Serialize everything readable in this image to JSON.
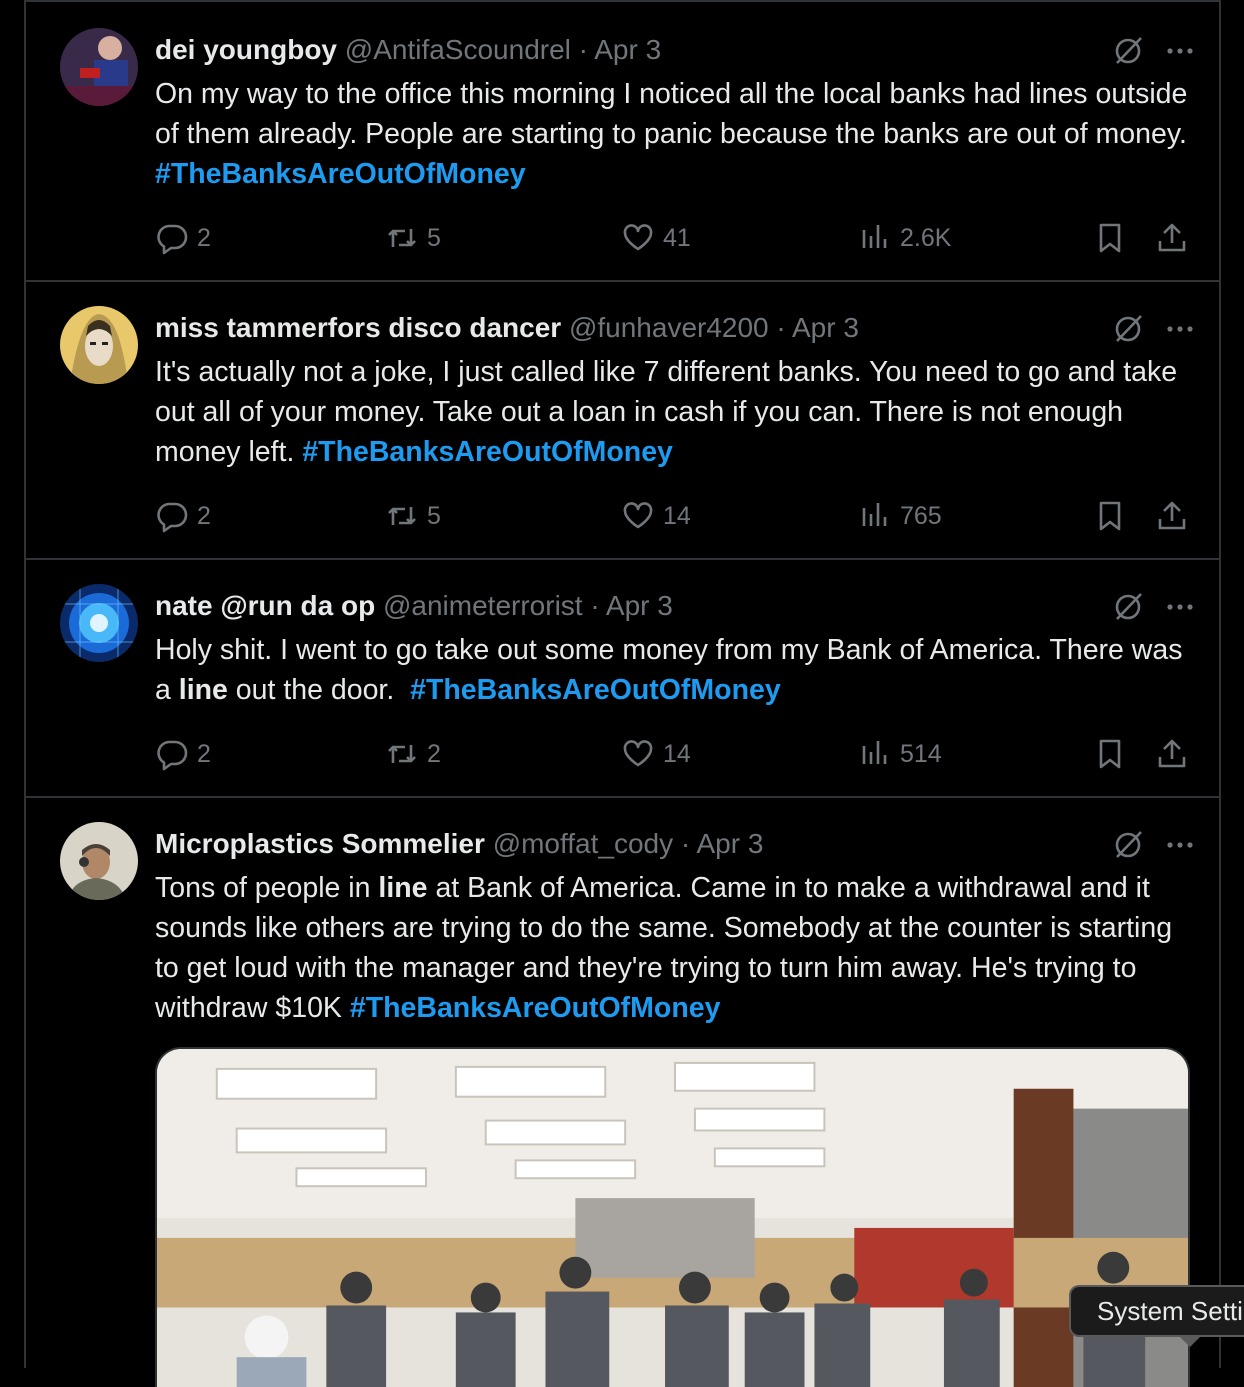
{
  "colors": {
    "background": "#000000",
    "text": "#e7e9ea",
    "muted": "#71767b",
    "hashtag": "#1d9bf0",
    "border": "#2f3336"
  },
  "icons": {
    "reply": "speech-bubble-icon",
    "retweet": "retweet-arrows-icon",
    "like": "heart-icon",
    "views": "bar-chart-icon",
    "bookmark": "bookmark-icon",
    "share": "share-upload-icon",
    "grok": "grok-slash-icon",
    "more": "ellipsis-icon"
  },
  "tweets": [
    {
      "name": "dei youngboy",
      "handle": "@AntifaScoundrel",
      "sep": "·",
      "date": "Apr 3",
      "text1": "On my way to the office this morning I noticed all the local banks had lines outside of them already. People are starting to panic because the banks are out of money. ",
      "hashtag": "#TheBanksAreOutOfMoney",
      "replies": "2",
      "retweets": "5",
      "likes": "41",
      "views": "2.6K"
    },
    {
      "name": "miss tammerfors disco dancer",
      "handle": "@funhaver4200",
      "sep": "·",
      "date": "Apr 3",
      "text1": "It's actually not a joke, I just called like 7 different banks. You need to go and take out all of your money. Take out a loan in cash if you can. There is not enough money left. ",
      "hashtag": "#TheBanksAreOutOfMoney",
      "replies": "2",
      "retweets": "5",
      "likes": "14",
      "views": "765"
    },
    {
      "name": "nate @run da op",
      "handle": "@animeterrorist",
      "sep": "·",
      "date": "Apr 3",
      "text1": "Holy shit. I went to go take out some money from my Bank of America. There was a ",
      "bold": "line",
      "text2": " out the door.  ",
      "hashtag": "#TheBanksAreOutOfMoney",
      "replies": "2",
      "retweets": "2",
      "likes": "14",
      "views": "514"
    },
    {
      "name": "Microplastics Sommelier",
      "handle": "@moffat_cody",
      "sep": "·",
      "date": "Apr 3",
      "text1": "Tons of people in ",
      "bold": "line",
      "text2": " at Bank of America. Came in to make a withdrawal and it sounds like others are trying to do the same. Somebody at the counter is starting to get loud with the manager and they're trying to turn him away. He's trying to withdraw $10K ",
      "hashtag": "#TheBanksAreOutOfMoney"
    }
  ],
  "tooltip": "System Settings"
}
